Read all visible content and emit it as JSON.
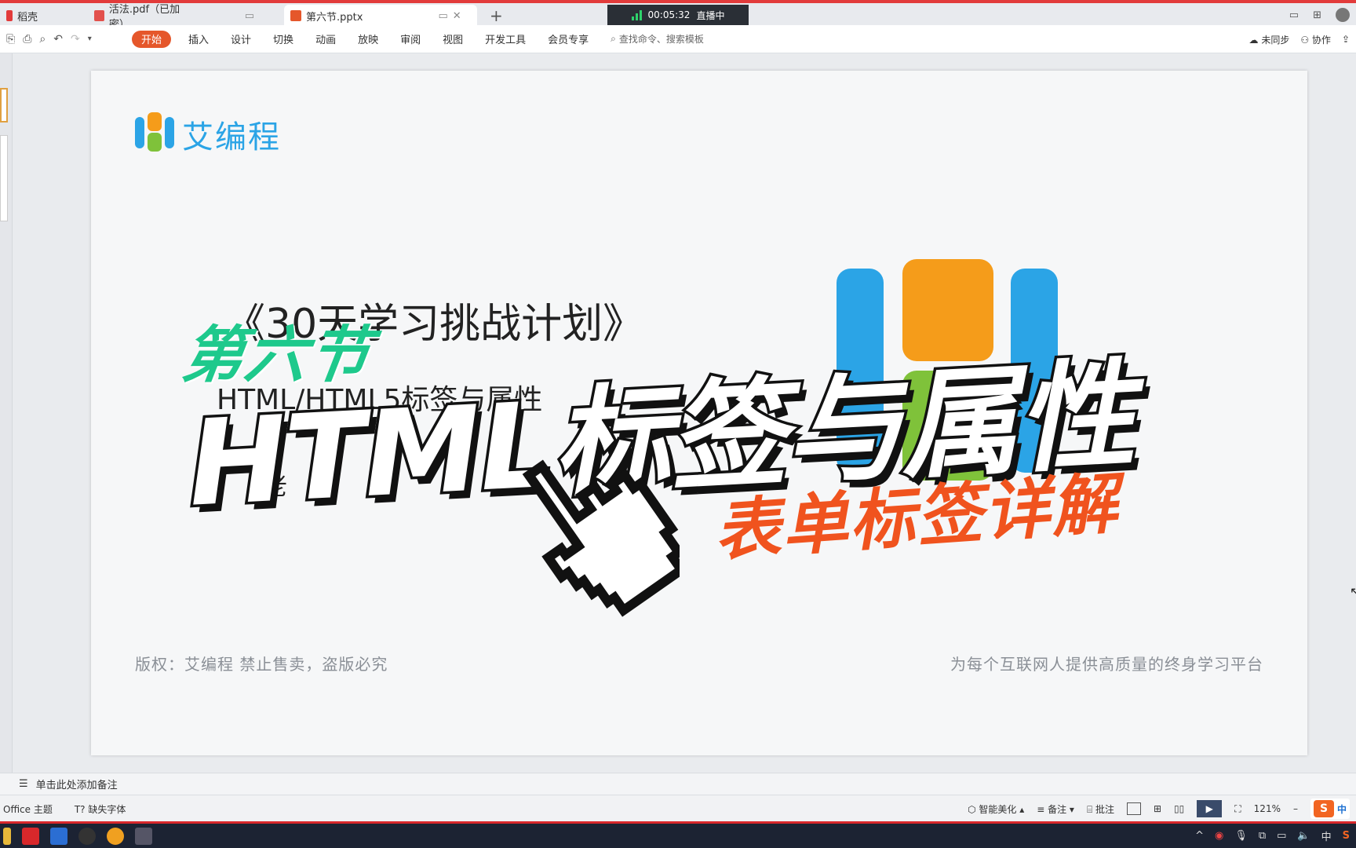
{
  "tabs": [
    {
      "label": "稻壳"
    },
    {
      "label": "活法.pdf（已加密）"
    },
    {
      "label": "第六节.pptx"
    }
  ],
  "live": {
    "time": "00:05:32",
    "status": "直播中"
  },
  "toolbar": {
    "menu": [
      "开始",
      "插入",
      "设计",
      "切换",
      "动画",
      "放映",
      "审阅",
      "视图",
      "开发工具",
      "会员专享"
    ],
    "search_placeholder": "查找命令、搜索模板",
    "sync_label": "未同步",
    "collab_label": "协作"
  },
  "slide": {
    "logo_text": "艾编程",
    "title": "《30天学习挑战计划》",
    "subtitle": "HTML/HTML5标签与属性",
    "teacher": "老",
    "overlay_lesson": "第六节",
    "overlay_main": "HTML标签与属性",
    "overlay_sub": "表单标签详解",
    "footer_left": "版权：艾编程   禁止售卖，盗版必究",
    "footer_right": "为每个互联网人提供高质量的终身学习平台",
    "colors": {
      "blue": "#2ba4e6",
      "orange": "#f59c1a",
      "green": "#7fc23a",
      "teal": "#1ec98c",
      "red": "#f0531e"
    }
  },
  "notes": {
    "placeholder": "单击此处添加备注"
  },
  "status": {
    "theme": "Office 主题",
    "missing_fonts": "缺失字体",
    "beautify": "智能美化",
    "notes_btn": "备注",
    "comment_btn": "批注",
    "zoom": "121%",
    "ime": "中"
  },
  "taskbar": {
    "ime": "中"
  }
}
